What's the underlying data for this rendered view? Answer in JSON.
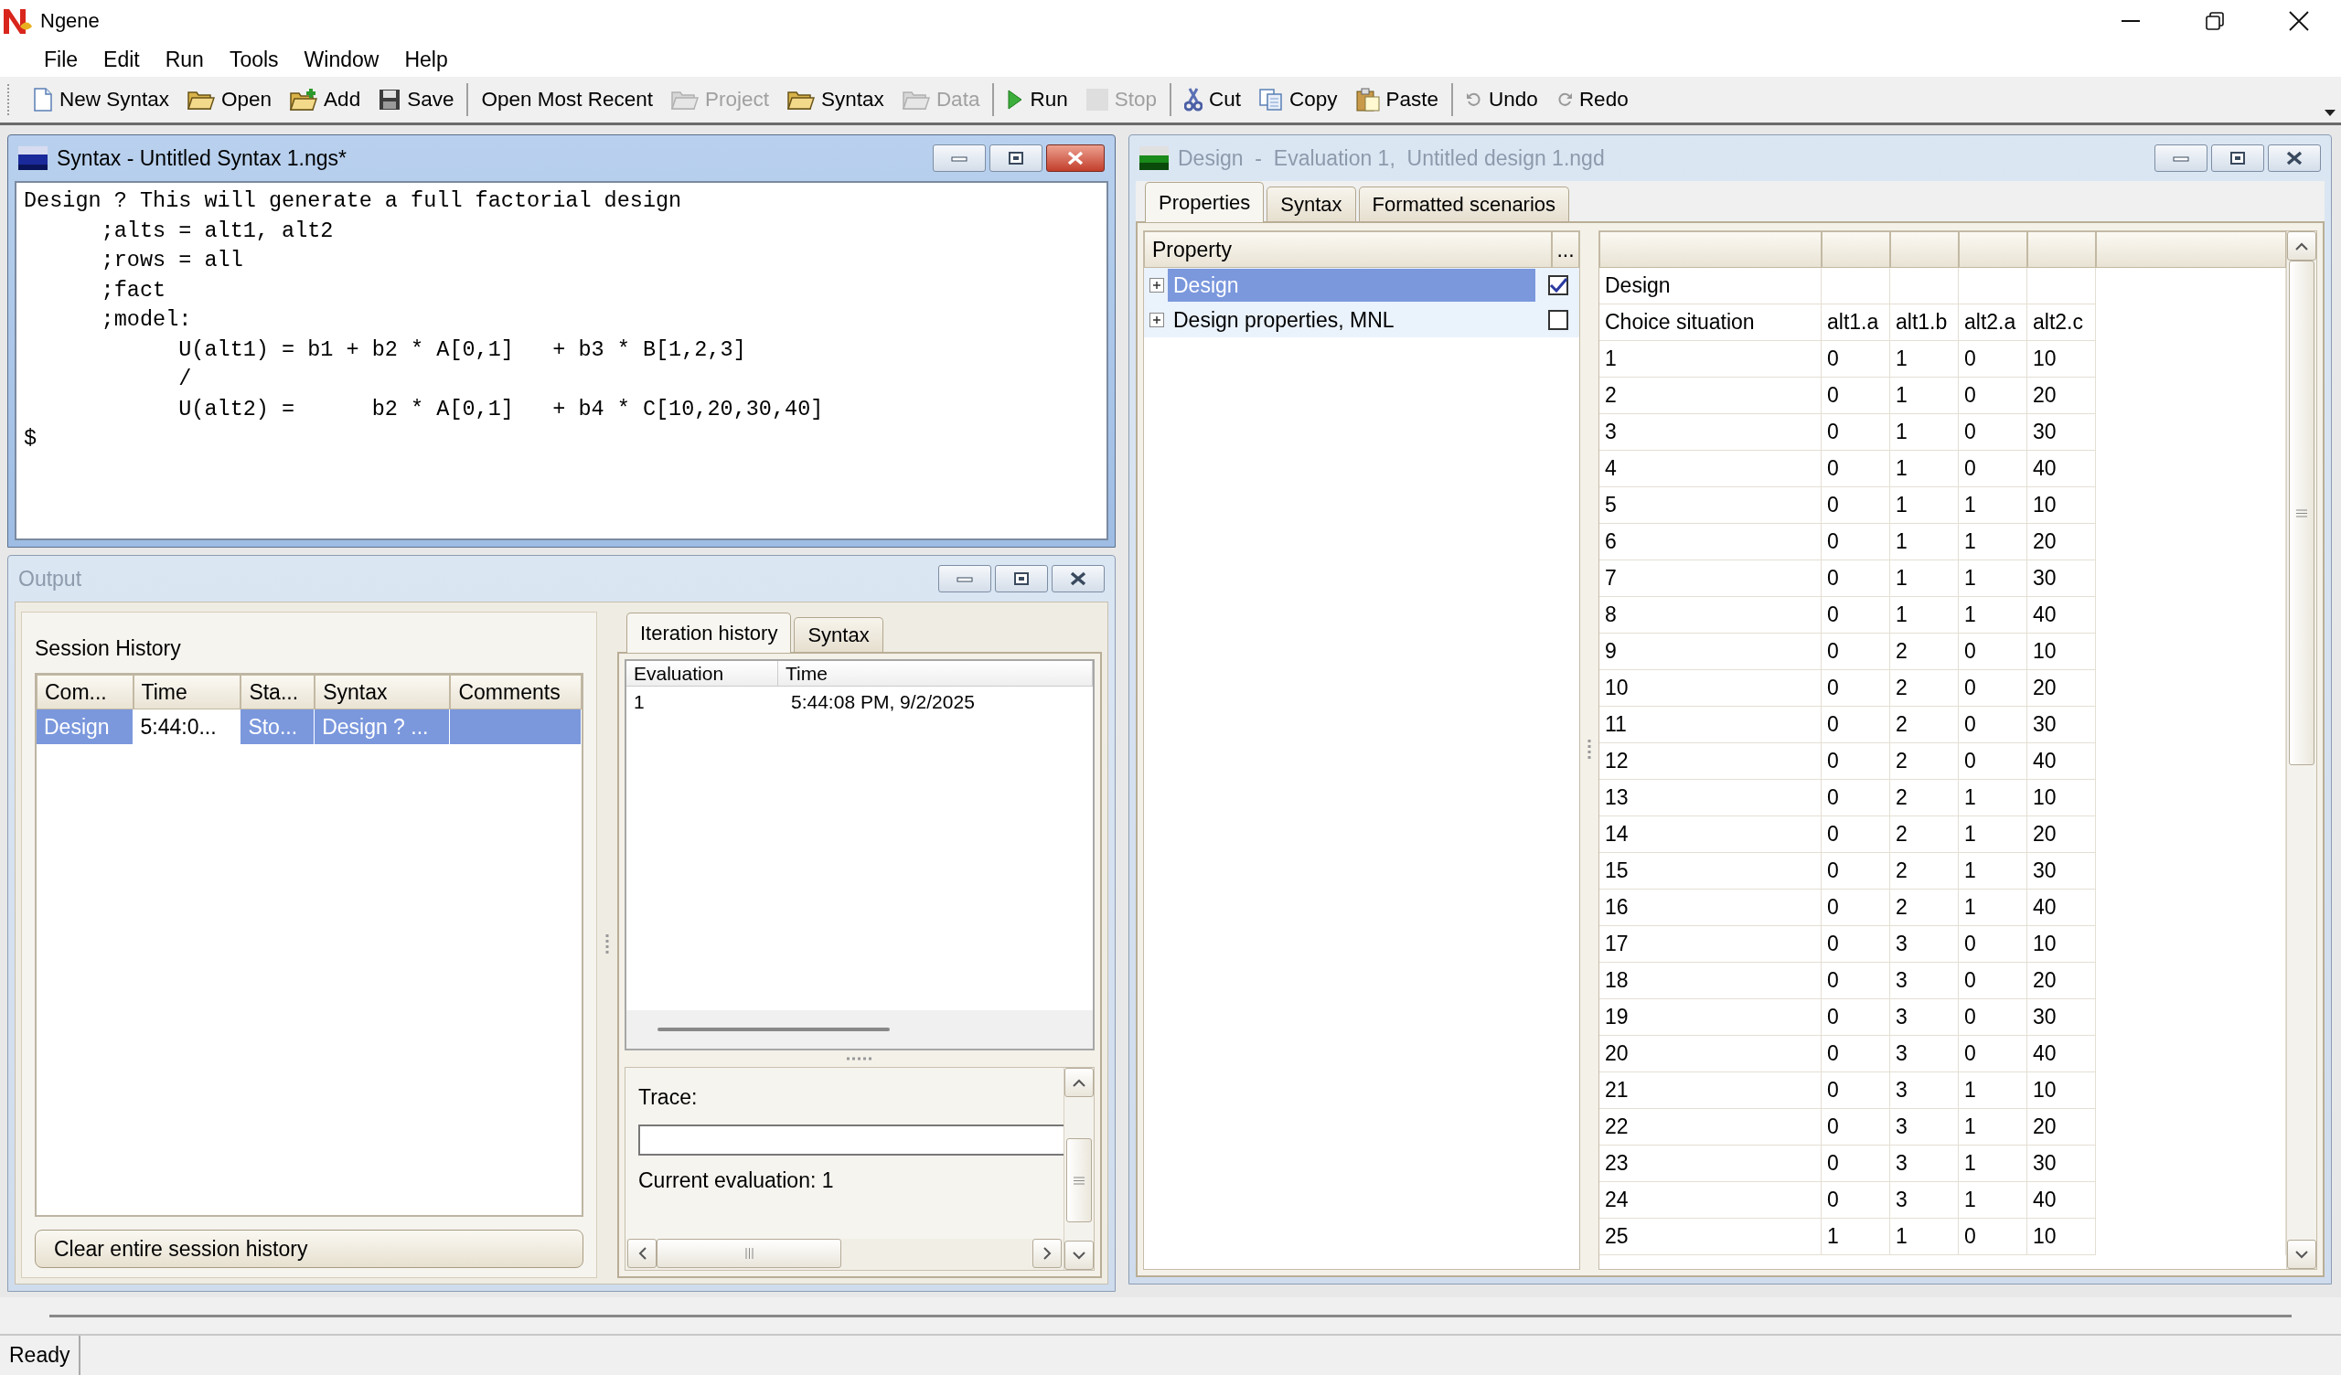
{
  "window": {
    "title": "Ngene"
  },
  "menu": [
    "File",
    "Edit",
    "Run",
    "Tools",
    "Window",
    "Help"
  ],
  "toolbar": [
    [
      {
        "label": "New Syntax",
        "kind": "page",
        "disabled": false
      },
      {
        "label": "Open",
        "kind": "folder",
        "disabled": false
      },
      {
        "label": "Add",
        "kind": "folder_add",
        "disabled": false
      },
      {
        "label": "Save",
        "kind": "floppy",
        "disabled": false
      }
    ],
    [
      {
        "label": "Open Most Recent",
        "kind": "text",
        "disabled": false
      },
      {
        "label": "Project",
        "kind": "folder",
        "disabled": true
      },
      {
        "label": "Syntax",
        "kind": "folder",
        "disabled": false
      },
      {
        "label": "Data",
        "kind": "folder",
        "disabled": true
      }
    ],
    [
      {
        "label": "Run",
        "kind": "play",
        "disabled": false
      },
      {
        "label": "Stop",
        "kind": "stop",
        "disabled": true
      }
    ],
    [
      {
        "label": "Cut",
        "kind": "cut",
        "disabled": false
      },
      {
        "label": "Copy",
        "kind": "copy",
        "disabled": false
      },
      {
        "label": "Paste",
        "kind": "paste",
        "disabled": false
      }
    ],
    [
      {
        "label": "Undo",
        "kind": "undo",
        "disabled": false
      },
      {
        "label": "Redo",
        "kind": "redo",
        "disabled": false
      }
    ]
  ],
  "syntax_window": {
    "title": "Syntax - Untitled Syntax 1.ngs*",
    "active": true,
    "lines": [
      "Design ? This will generate a full factorial design",
      "      ;alts = alt1, alt2",
      "      ;rows = all",
      "      ;fact",
      "      ;model:",
      "            U(alt1) = b1 + b2 * A[0,1]   + b3 * B[1,2,3]",
      "            /",
      "            U(alt2) =      b2 * A[0,1]   + b4 * C[10,20,30,40]",
      "$"
    ]
  },
  "output": {
    "title": "Output",
    "active": false,
    "session_history": {
      "title": "Session History",
      "columns": [
        "Com...",
        "Time",
        "Sta...",
        "Syntax",
        "Comments"
      ],
      "rows": [
        {
          "selected": true,
          "cells": [
            {
              "text": "Design",
              "focused": false
            },
            {
              "text": "5:44:0...",
              "focused": true
            },
            {
              "text": "Sto...",
              "focused": false
            },
            {
              "text": "Design ? ...",
              "focused": false
            }
          ]
        }
      ]
    },
    "clear_button": "Clear entire session history",
    "tabs": [
      {
        "label": "Iteration history",
        "selected": true
      },
      {
        "label": "Syntax",
        "selected": false
      }
    ],
    "iteration_table": {
      "columns": [
        "Evaluation",
        "Time"
      ],
      "rows": [
        [
          "1",
          "5:44:08 PM, 9/2/2025"
        ]
      ]
    },
    "trace_label": "Trace:",
    "current_evaluation": "Current evaluation: 1"
  },
  "design_window": {
    "title": "Design  -  Evaluation 1,  Untitled design 1.ngd",
    "active": false,
    "tabs": [
      {
        "label": "Properties",
        "selected": true
      },
      {
        "label": "Syntax",
        "selected": false
      },
      {
        "label": "Formatted scenarios",
        "selected": false
      }
    ],
    "property_header": "Property",
    "property_more": "...",
    "properties": [
      {
        "label": "Design",
        "selected": true,
        "checked": true,
        "expanded": false
      },
      {
        "label": "Design properties, MNL",
        "selected": false,
        "checked": false,
        "expanded": false
      }
    ],
    "grid": {
      "title_row": "Design",
      "columns": [
        "Choice situation",
        "alt1.a",
        "alt1.b",
        "alt2.a",
        "alt2.c"
      ],
      "rows": [
        [
          "1",
          "0",
          "1",
          "0",
          "10"
        ],
        [
          "2",
          "0",
          "1",
          "0",
          "20"
        ],
        [
          "3",
          "0",
          "1",
          "0",
          "30"
        ],
        [
          "4",
          "0",
          "1",
          "0",
          "40"
        ],
        [
          "5",
          "0",
          "1",
          "1",
          "10"
        ],
        [
          "6",
          "0",
          "1",
          "1",
          "20"
        ],
        [
          "7",
          "0",
          "1",
          "1",
          "30"
        ],
        [
          "8",
          "0",
          "1",
          "1",
          "40"
        ],
        [
          "9",
          "0",
          "2",
          "0",
          "10"
        ],
        [
          "10",
          "0",
          "2",
          "0",
          "20"
        ],
        [
          "11",
          "0",
          "2",
          "0",
          "30"
        ],
        [
          "12",
          "0",
          "2",
          "0",
          "40"
        ],
        [
          "13",
          "0",
          "2",
          "1",
          "10"
        ],
        [
          "14",
          "0",
          "2",
          "1",
          "20"
        ],
        [
          "15",
          "0",
          "2",
          "1",
          "30"
        ],
        [
          "16",
          "0",
          "2",
          "1",
          "40"
        ],
        [
          "17",
          "0",
          "3",
          "0",
          "10"
        ],
        [
          "18",
          "0",
          "3",
          "0",
          "20"
        ],
        [
          "19",
          "0",
          "3",
          "0",
          "30"
        ],
        [
          "20",
          "0",
          "3",
          "0",
          "40"
        ],
        [
          "21",
          "0",
          "3",
          "1",
          "10"
        ],
        [
          "22",
          "0",
          "3",
          "1",
          "20"
        ],
        [
          "23",
          "0",
          "3",
          "1",
          "30"
        ],
        [
          "24",
          "0",
          "3",
          "1",
          "40"
        ],
        [
          "25",
          "1",
          "1",
          "0",
          "10"
        ]
      ]
    }
  },
  "status_bar": "Ready"
}
